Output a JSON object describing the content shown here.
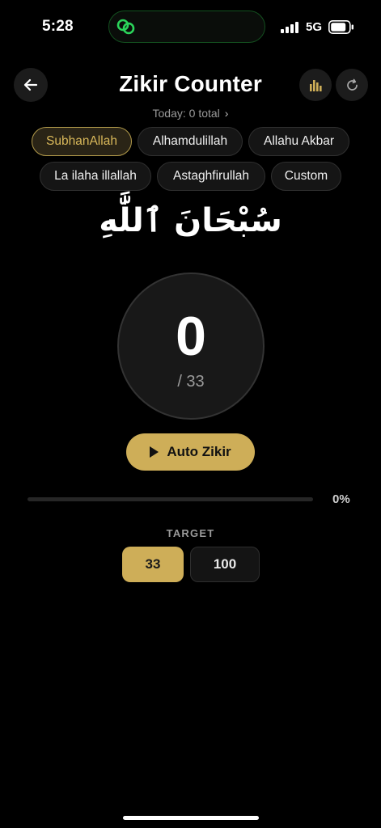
{
  "status_bar": {
    "time": "5:28",
    "network": "5G"
  },
  "header": {
    "title": "Zikir Counter",
    "today_summary": "Today: 0 total",
    "today_chevron": "›"
  },
  "icons": {
    "back": "arrow-left-icon",
    "stats": "bar-chart-icon",
    "reset": "refresh-icon"
  },
  "chips_row1": [
    "SubhanAllah",
    "Alhamdulillah",
    "Allahu Akbar"
  ],
  "chips_row2": [
    "La ilaha illallah",
    "Astaghfirullah",
    "Custom"
  ],
  "selected_dhikr": "SubhanAllah",
  "arabic_text": "سُبْحَانَ ٱللَّٰهِ",
  "counter": {
    "count": "0",
    "target": "/ 33"
  },
  "auto_button": {
    "label": "Auto Zikir"
  },
  "progress": {
    "value": 0,
    "label": "0%"
  },
  "target": {
    "label": "TARGET",
    "options": [
      "33",
      "100"
    ],
    "selected": "33"
  },
  "colors": {
    "accent": "#ceae58",
    "background": "#000000",
    "surface": "#181818"
  }
}
